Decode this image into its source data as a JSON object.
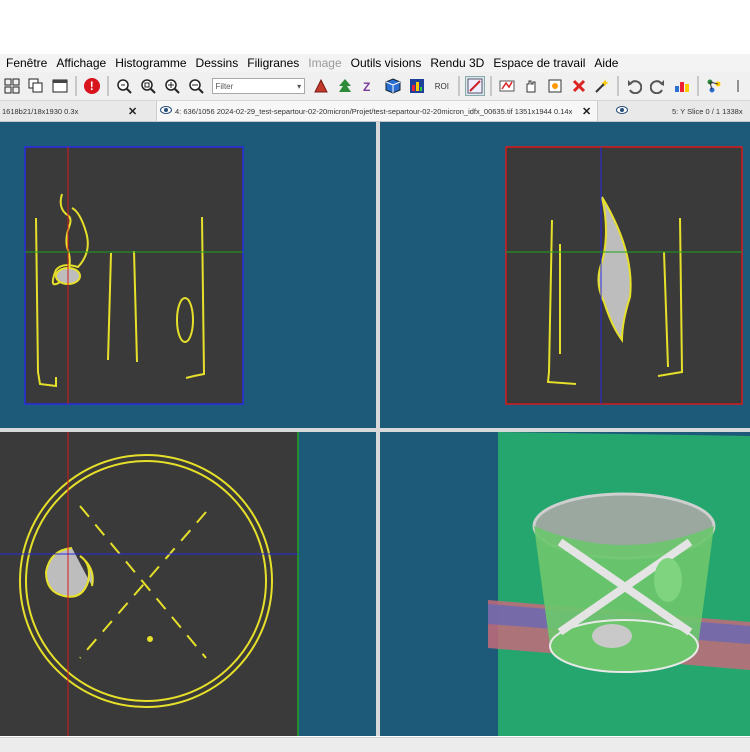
{
  "menu": [
    "Fenêtre",
    "Affichage",
    "Histogramme",
    "Dessins",
    "Filigranes",
    "Image",
    "Outils visions",
    "Rendu 3D",
    "Espace de travail",
    "Aide"
  ],
  "menu_disabled_index": 5,
  "toolbar": {
    "filter_value": "Filter",
    "roi_label": "ROI"
  },
  "tabs": [
    {
      "label": "1618b21/18x1930  0.3x",
      "close": "✕"
    },
    {
      "label": "4: 636/1056 2024-02-29_test-separtour-02-20micron/Projet/test-separtour-02-20micron_idfx_00635.tif 1351x1944 0.14x",
      "close": "✕"
    },
    {
      "label": "5: Y Slice 0 / 1   1338x",
      "close": ""
    }
  ],
  "colors": {
    "background_blue": "#1d5a7a",
    "slice_gray": "#3a3a3a",
    "segmentation_yellow": "#e6e02a",
    "crosshair_red": "#d81b1b",
    "crosshair_green": "#1fa21f",
    "crosshair_blue": "#2a2ae0",
    "render_green": "#6cc76c"
  }
}
